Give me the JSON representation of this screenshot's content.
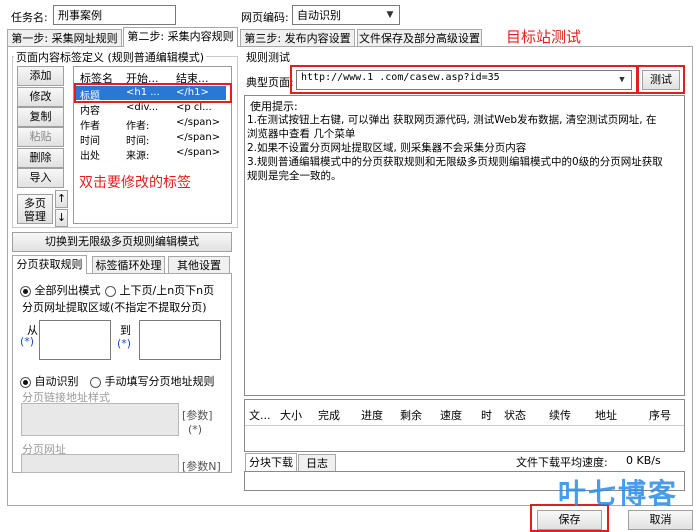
{
  "top": {
    "task_name_label": "任务名:",
    "task_name_value": "刑事案例",
    "encoding_label": "网页编码:",
    "encoding_value": "自动识别"
  },
  "tabs": [
    "第一步: 采集网址规则",
    "第二步: 采集内容规则",
    "第三步: 发布内容设置",
    "文件保存及部分高级设置"
  ],
  "annotation_target": "目标站测试",
  "left": {
    "group_title": "页面内容标签定义 (规则普通编辑模式)",
    "buttons": [
      "添加",
      "修改",
      "复制",
      "粘贴",
      "删除",
      "导入"
    ],
    "multi_page_button": "多页\n管理",
    "up_arrow": "↑",
    "down_arrow": "↓",
    "table_headers": [
      "标签名",
      "开始...",
      "结束..."
    ],
    "rows": [
      [
        "标题",
        "<h1 ...",
        "</h1>"
      ],
      [
        "内容",
        "<div...",
        "<p cl..."
      ],
      [
        "作者",
        "作者:",
        "</span>"
      ],
      [
        "时间",
        "时间:",
        "</span>"
      ],
      [
        "出处",
        "来源:",
        "</span>"
      ]
    ],
    "annotation_edit": "双击要修改的标签",
    "switch_button": "切换到无限级多页规则编辑模式",
    "subtabs": [
      "分页获取规则",
      "标签循环处理",
      "其他设置"
    ],
    "radio_all": "全部列出模式",
    "radio_prevnext": "上下页/上n页下n页",
    "area_label": "分页网址提取区域(不指定不提取分页)",
    "from_label": "从",
    "to_label": "到",
    "star": "(*)",
    "radio_auto": "自动识别",
    "radio_manual": "手动填写分页地址规则",
    "link_style_label": "分页链接地址样式",
    "param_btn": "[参数]",
    "param_star": "(*)",
    "page_url_label": "分页网址",
    "paramN_btn": "[参数N]"
  },
  "right": {
    "group_title": "规则测试",
    "typical_page_label": "典型页面:",
    "typical_page_value": "http://www.1          .com/casew.asp?id=35",
    "test_button": "测试",
    "hints": [
      "使用提示:",
      "1.在测试按钮上右键, 可以弹出 获取网页源代码, 测试Web发布数据, 清空测试页网址, 在",
      "浏览器中查看 几个菜单",
      "2.如果不设置分页网址提取区域, 则采集器不会采集分页内容",
      "3.规则普通编辑模式中的分页获取规则和无限级多页规则编辑模式中的0级的分页网址获取",
      "规则是完全一致的。"
    ],
    "download_headers": [
      "文...",
      "大小",
      "完成",
      "进度",
      "剩余",
      "速度",
      "时",
      "状态",
      "续传",
      "地址",
      "序号"
    ],
    "bottom_tabs": [
      "分块下载",
      "日志"
    ],
    "avg_speed_label": "文件下载平均速度:",
    "avg_speed_value": "0 KB/s"
  },
  "footer": {
    "save": "保存",
    "cancel": "取消"
  },
  "watermark": "叶七博客"
}
